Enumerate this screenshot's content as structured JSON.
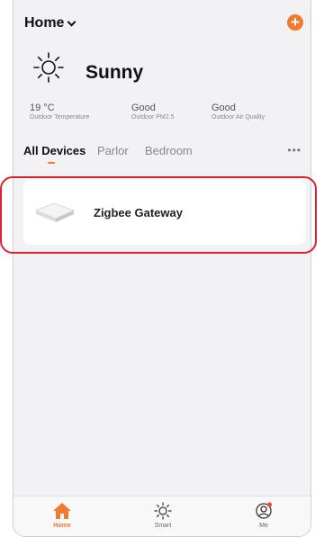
{
  "header": {
    "title": "Home",
    "add_icon": "plus-circle-icon",
    "accent": "#ef7a30"
  },
  "weather": {
    "condition": "Sunny",
    "icon": "sun-icon",
    "stats": [
      {
        "value": "19 °C",
        "caption": "Outdoor Temperature"
      },
      {
        "value": "Good",
        "caption": "Outdoor PM2.5"
      },
      {
        "value": "Good",
        "caption": "Outdoor Air Quality"
      }
    ]
  },
  "tabs": [
    {
      "label": "All Devices",
      "active": true
    },
    {
      "label": "Parlor",
      "active": false
    },
    {
      "label": "Bedroom",
      "active": false
    }
  ],
  "more": "•••",
  "devices": [
    {
      "name": "Zigbee Gateway",
      "icon": "gateway-icon"
    }
  ],
  "highlight_color": "#d8242f",
  "bottom_nav": [
    {
      "label": "Home",
      "icon": "home-icon",
      "active": true
    },
    {
      "label": "Smart",
      "icon": "sun-icon",
      "active": false
    },
    {
      "label": "Me",
      "icon": "user-icon",
      "active": false
    }
  ]
}
